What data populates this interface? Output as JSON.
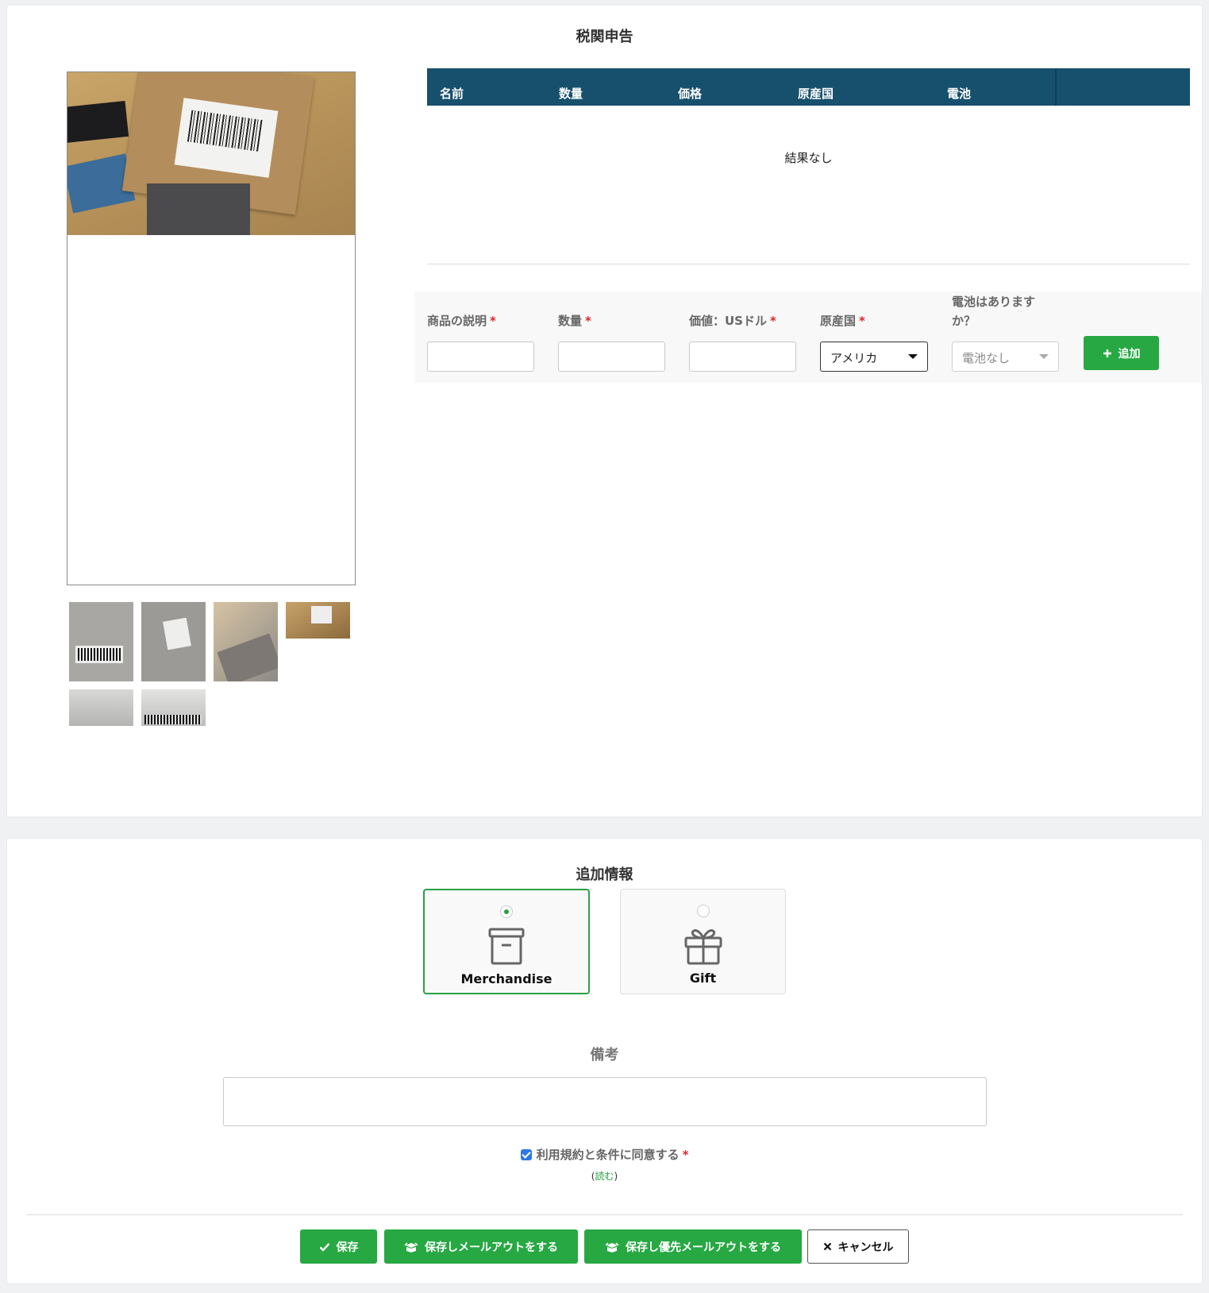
{
  "customs": {
    "title": "税関申告",
    "table": {
      "columns": [
        "名前",
        "数量",
        "価格",
        "原産国",
        "電池"
      ],
      "empty_text": "結果なし"
    },
    "form": {
      "description_label": "商品の説明",
      "quantity_label": "数量",
      "value_label": "価値：USドル",
      "origin_label": "原産国",
      "origin_value": "アメリカ",
      "battery_label_line1": "電池はあります",
      "battery_label_line2": "か？",
      "battery_value": "電池なし",
      "required_mark": "*",
      "add_button": "追加"
    }
  },
  "additional": {
    "title": "追加情報",
    "options": [
      {
        "label": "Merchandise",
        "selected": true,
        "icon": "archive-box-icon"
      },
      {
        "label": "Gift",
        "selected": false,
        "icon": "gift-icon"
      }
    ],
    "notes_title": "備考",
    "notes_value": "",
    "terms_label": "利用規約と条件に同意する",
    "terms_required": "*",
    "terms_checked": true,
    "read_open": "(",
    "read_link": "読む",
    "read_close": ")"
  },
  "actions": {
    "save": "保存",
    "save_mail": "保存しメールアウトをする",
    "save_priority_mail": "保存し優先メールアウトをする",
    "cancel": "キャンセル"
  },
  "colors": {
    "accent_green": "#27a843",
    "table_header": "#17506c",
    "required_red": "#d9262c",
    "checkbox_blue": "#2f78e4"
  }
}
